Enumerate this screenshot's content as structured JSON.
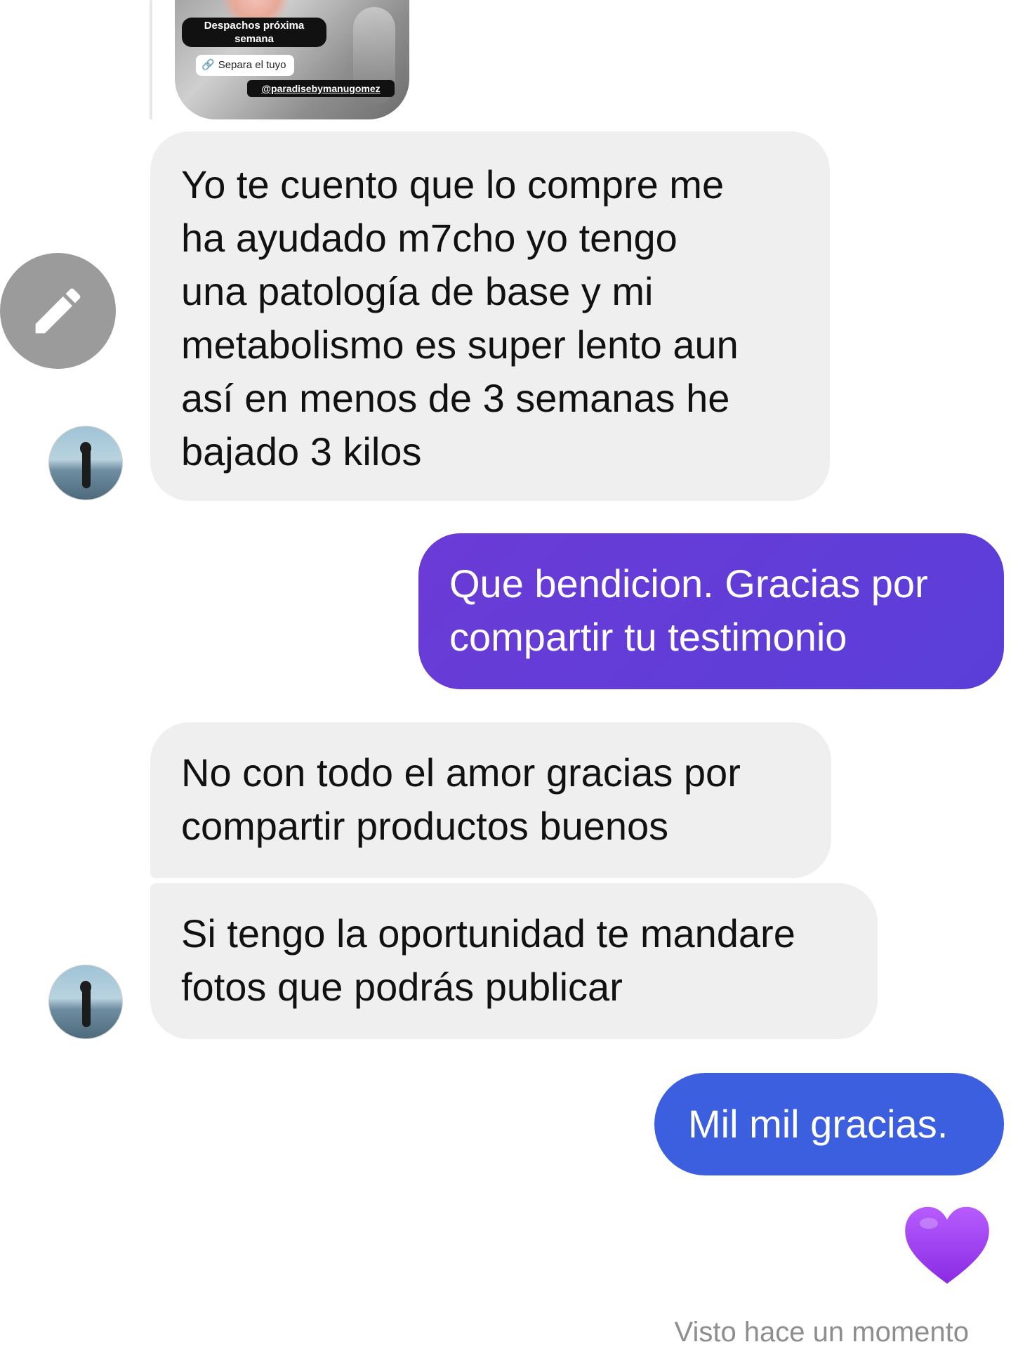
{
  "story": {
    "tag_line1": "Despachos próxima",
    "tag_line2": "semana",
    "link_label": "Separa el tuyo",
    "handle": "@paradisebymanugomez"
  },
  "messages": [
    {
      "direction": "incoming",
      "lines": [
        "Yo te cuento que lo compre me",
        "ha ayudado m7cho yo tengo",
        "una patología de base y mi",
        "metabolismo es super lento aun",
        "así en menos de 3 semanas he",
        "bajado 3 kilos"
      ]
    },
    {
      "direction": "outgoing",
      "lines": [
        "Que bendicion. Gracias por",
        "compartir tu testimonio"
      ]
    },
    {
      "direction": "incoming",
      "lines": [
        "No con todo el amor gracias por",
        "compartir productos buenos"
      ]
    },
    {
      "direction": "incoming",
      "lines": [
        "Si tengo la oportunidad te mandare",
        "fotos que podrás publicar"
      ]
    },
    {
      "direction": "outgoing",
      "lines": [
        "Mil mil gracias."
      ]
    }
  ],
  "reaction": {
    "icon": "purple-heart-icon",
    "color": "#9b3cf0"
  },
  "status": {
    "seen_text": "Visto hace un momento"
  },
  "colors": {
    "incoming_bubble": "#efefef",
    "outgoing_purple": "#5f3ed8",
    "outgoing_blue": "#3b5fdf"
  }
}
